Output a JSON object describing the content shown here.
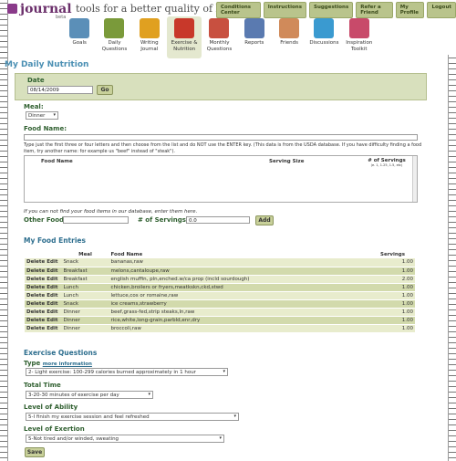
{
  "brand": {
    "name": "journal",
    "beta": "beta",
    "tagline": "tools for a better quality of life"
  },
  "topnav": [
    "Conditions Center",
    "Instructions",
    "Suggestions",
    "Refer a Friend",
    "My Profile",
    "Logout"
  ],
  "nav": [
    {
      "icon": "goals-icon",
      "label": "Goals",
      "color": "#5b8fb8"
    },
    {
      "icon": "daily-questions-icon",
      "label": "Daily Questions",
      "color": "#7a9a3a"
    },
    {
      "icon": "writing-journal-icon",
      "label": "Writing Journal",
      "color": "#e0a020"
    },
    {
      "icon": "apple-icon",
      "label": "Exercise & Nutrition",
      "color": "#c8382a",
      "active": true
    },
    {
      "icon": "calendar-icon",
      "label": "Monthly Questions",
      "color": "#c85040"
    },
    {
      "icon": "reports-icon",
      "label": "Reports",
      "color": "#5a7ab0"
    },
    {
      "icon": "friends-icon",
      "label": "Friends",
      "color": "#d08a5a"
    },
    {
      "icon": "discussions-icon",
      "label": "Discussions",
      "color": "#3a9ad0"
    },
    {
      "icon": "inspiration-icon",
      "label": "Inspiration Toolkit",
      "color": "#c84a6a"
    }
  ],
  "page_title": "My Daily Nutrition",
  "date": {
    "label": "Date",
    "value": "08/14/2009",
    "go": "Go"
  },
  "meal": {
    "label": "Meal:",
    "value": "Dinner"
  },
  "food_name": {
    "label": "Food Name:",
    "hint": "Type just the first three or four letters and then choose from the list and do NOT use the ENTER key. (This data is from the USDA database. If you have difficulty finding a food item, try another name: for example us \"beef\" instead of \"steak\").",
    "col_food": "Food Name",
    "col_size": "Serving Size",
    "col_servings": "# of Servings",
    "col_servings_sub": "(e. 1, 1.25, 1.5, etc)"
  },
  "other_food": {
    "note": "If you can not find your food items in our database, enter them here.",
    "label": "Other Food:",
    "servings_label": "# of Servings:",
    "servings_value": "0.0",
    "add": "Add"
  },
  "entries": {
    "title": "My Food Entries",
    "headers": [
      "Meal",
      "Food Name",
      "Servings"
    ],
    "delete": "Delete",
    "edit": "Edit",
    "rows": [
      {
        "meal": "Snack",
        "food": "bananas,raw",
        "servings": "1.00"
      },
      {
        "meal": "Breakfast",
        "food": "melons,cantaloupe,raw",
        "servings": "1.00"
      },
      {
        "meal": "Breakfast",
        "food": "english muffin, pln,enched.w/ca prop (incld sourdough)",
        "servings": "2.00"
      },
      {
        "meal": "Lunch",
        "food": "chicken,broilers or fryers,meatkskn,ckd,stwd",
        "servings": "1.00"
      },
      {
        "meal": "Lunch",
        "food": "lettuce,cos or romaine,raw",
        "servings": "1.00"
      },
      {
        "meal": "Snack",
        "food": "ice creams,strawberry",
        "servings": "1.00"
      },
      {
        "meal": "Dinner",
        "food": "beef,grass-fed,strip steaks,ln,raw",
        "servings": "1.00"
      },
      {
        "meal": "Dinner",
        "food": "rice,white,long-grain,parbld,enr,dry",
        "servings": "1.00"
      },
      {
        "meal": "Dinner",
        "food": "broccoli,raw",
        "servings": "1.00"
      }
    ]
  },
  "exercise": {
    "title": "Exercise Questions",
    "type_label": "Type",
    "more_info": "more information",
    "type_value": "2- Light exercise: 100-299 calories burned approximately in 1 hour",
    "time_label": "Total Time",
    "time_value": "3-20-30 minutes of exercise per day",
    "ability_label": "Level of Ability",
    "ability_value": "5-I finish my exercise session and feel refreshed",
    "exertion_label": "Level of Exertion",
    "exertion_value": "5-Not tired and/or winded, sweating",
    "save": "Save"
  }
}
